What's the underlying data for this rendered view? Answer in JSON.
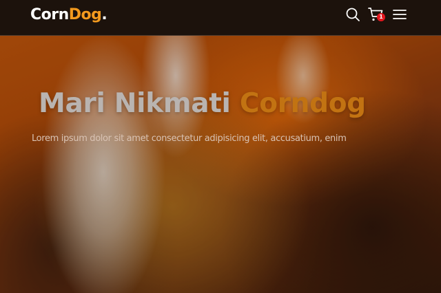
{
  "header": {
    "logo_part1": "Corn",
    "logo_part2": "Dog",
    "logo_dot": ".",
    "search_icon": "search-icon",
    "cart_icon": "cart-icon",
    "cart_count": "1",
    "menu_icon": "hamburger-menu-icon"
  },
  "hero": {
    "title_part1": "Mari Nikmati",
    "title_part2": "Corndog",
    "subtitle": "Lorem ipsum dolor sit amet consectetur adipisicing elit, accusatium, enim"
  },
  "colors": {
    "header_bg": "#1c120c",
    "accent": "#f39a1e",
    "badge": "#e4161e"
  }
}
